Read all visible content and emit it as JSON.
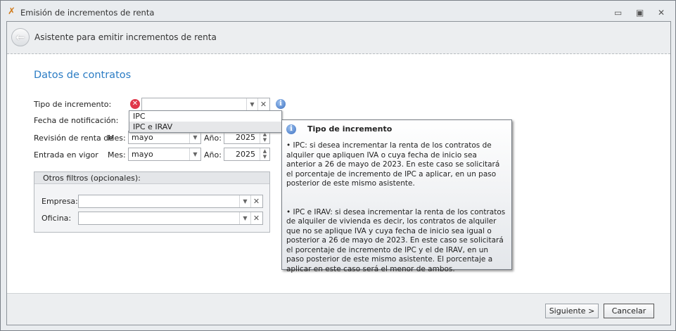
{
  "window": {
    "title": "Emisión de incrementos de renta",
    "icon": "tools-icon"
  },
  "header": {
    "title": "Asistente para emitir incrementos de renta"
  },
  "section": {
    "title": "Datos  de contratos"
  },
  "form": {
    "tipo_label": "Tipo de incremento:",
    "tipo_value": "",
    "options": [
      "IPC",
      "IPC e IRAV"
    ],
    "fecha_label": "Fecha de notificación:",
    "revision_label": "Revisión de renta de",
    "revision_mes_label": "Mes:",
    "revision_mes": "mayo",
    "revision_anio_label": "Año:",
    "revision_anio": "2025",
    "entrada_label": "Entrada en vigor",
    "entrada_mes_label": "Mes:",
    "entrada_mes": "mayo",
    "entrada_anio_label": "Año:",
    "entrada_anio": "2025"
  },
  "filters": {
    "title": "Otros filtros (opcionales):",
    "empresa_label": "Empresa:",
    "empresa_value": "",
    "oficina_label": "Oficina:",
    "oficina_value": ""
  },
  "tooltip": {
    "title": "Tipo de incremento",
    "p1": "• IPC: si desea incrementar la renta de los contratos de alquiler que apliquen IVA o cuya fecha de inicio sea anterior a 26 de mayo de 2023. En este caso se solicitará el porcentaje de incremento de IPC a aplicar, en un paso posterior de este mismo asistente.",
    "p2": "• IPC e IRAV: si desea incrementar la renta de los contratos de alquiler de vivienda es decir, los contratos de alquiler que no se aplique IVA y cuya fecha de inicio sea igual o posterior a 26 de mayo de 2023. En este caso se solicitará el porcentaje de incremento de IPC y el de IRAV, en un paso posterior de este mismo asistente. El porcentaje a aplicar en este caso será el menor de ambos."
  },
  "footer": {
    "next": "Siguiente >",
    "cancel": "Cancelar"
  }
}
